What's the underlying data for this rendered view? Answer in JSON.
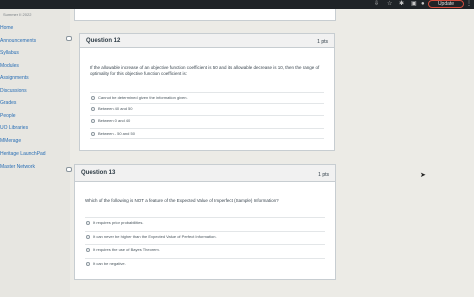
{
  "browser": {
    "update_label": "Update",
    "icons": [
      "download-icon",
      "star-icon",
      "extension-icon",
      "sidebar-icon",
      "profile-icon",
      "more-icon"
    ]
  },
  "nav": {
    "term": "Summer II 2022",
    "items": [
      "Home",
      "Announcements",
      "Syllabus",
      "Modules",
      "Assignments",
      "Discussions",
      "Grades",
      "People",
      "UO Libraries",
      "MMerage",
      "Heritage LaunchPad",
      "Master Network"
    ]
  },
  "questions": [
    {
      "title": "Question 12",
      "points": "1 pts",
      "text": "If the allowable increase of an objective function coefficient is 50 and its allowable decrease is 10, then the range of optimality for this objective function coefficient is:",
      "options": [
        "Cannot be determined given the information given.",
        "Between 40 and 50",
        "Between 0 and 40",
        "Between - 50 and 50"
      ]
    },
    {
      "title": "Question 13",
      "points": "1 pts",
      "text": "Which of the following is NOT a feature of the Expected Value of Imperfect (Sample) Information?",
      "options": [
        "It requires prior probabilities.",
        "It can never be higher than the Expected Value of Perfect Information.",
        "It requires the use of Bayes Theorem.",
        "It can be negative."
      ]
    }
  ]
}
